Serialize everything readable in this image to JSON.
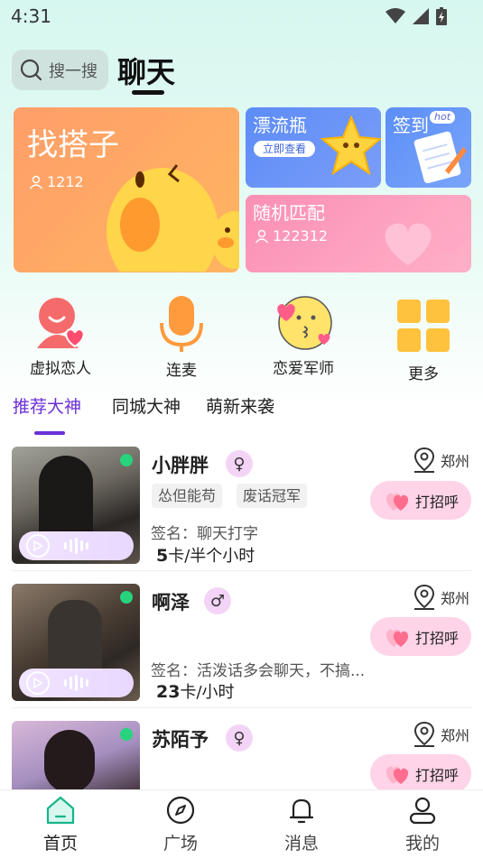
{
  "status": {
    "time": "4:31"
  },
  "header": {
    "search_placeholder": "搜一搜",
    "title": "聊天"
  },
  "banners": {
    "find_partner": {
      "title": "找搭子",
      "count": "1212"
    },
    "drift_bottle": {
      "title": "漂流瓶",
      "button": "立即查看"
    },
    "sign_in": {
      "title": "签到",
      "badge": "hot"
    },
    "random_match": {
      "title": "随机匹配",
      "count": "122312"
    }
  },
  "quick_actions": [
    {
      "label": "虚拟恋人",
      "icon": "heart-person-icon"
    },
    {
      "label": "连麦",
      "icon": "microphone-icon"
    },
    {
      "label": "恋爱军师",
      "icon": "kissing-face-icon"
    },
    {
      "label": "更多",
      "icon": "grid-icon"
    }
  ],
  "tabs": [
    "推荐大神",
    "同城大神",
    "萌新来袭"
  ],
  "users": [
    {
      "name": "小胖胖",
      "gender": "♀",
      "tags": [
        "怂但能苟",
        "废话冠军"
      ],
      "signature": "签名：聊天打字",
      "price_num": "5",
      "price_unit": "卡/半个小时",
      "location": "郑州",
      "greet": "打招呼"
    },
    {
      "name": "啊泽",
      "gender": "♂",
      "tags": [],
      "signature": "签名：活泼话多会聊天，不搞...",
      "price_num": "23",
      "price_unit": "卡/小时",
      "location": "郑州",
      "greet": "打招呼"
    },
    {
      "name": "苏陌予",
      "gender": "♀",
      "tags": [],
      "signature": "",
      "price_num": "",
      "price_unit": "",
      "location": "郑州",
      "greet": "打招呼"
    }
  ],
  "nav": [
    {
      "label": "首页",
      "icon": "home-icon"
    },
    {
      "label": "广场",
      "icon": "compass-icon"
    },
    {
      "label": "消息",
      "icon": "bell-icon"
    },
    {
      "label": "我的",
      "icon": "user-icon"
    }
  ],
  "colors": {
    "accent": "#6c2fd7",
    "online": "#27d37d",
    "greet_bg": "#ffd3e8"
  }
}
